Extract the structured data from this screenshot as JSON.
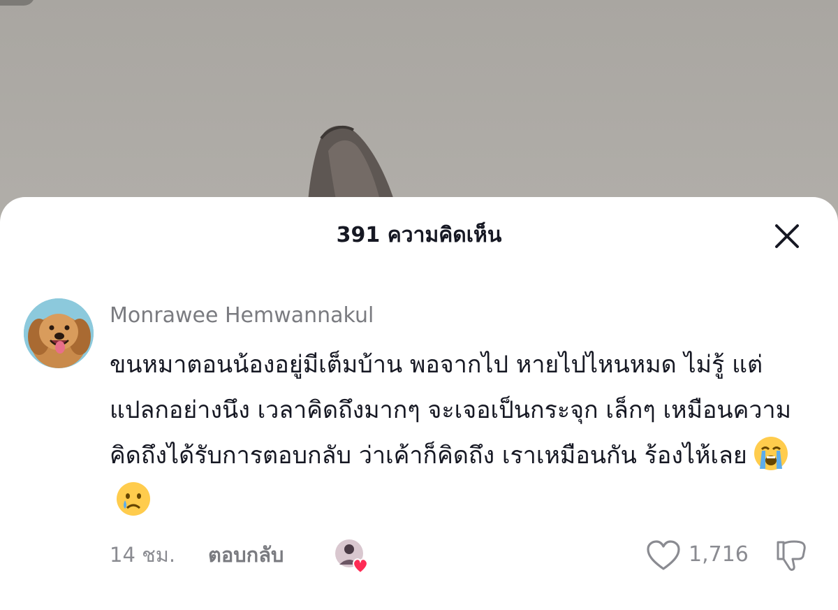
{
  "comments_sheet": {
    "title": "391 ความคิดเห็น"
  },
  "comment": {
    "author": "Monrawee Hemwannakul",
    "text": "ขนหมาตอนน้องอยู่มีเต็มบ้าน พอจากไป หายไปไหนหมด ไม่รู้ แต่แปลกอย่างนึง เวลาคิดถึงมากๆ จะเจอเป็นกระจุก เล็กๆ เหมือนความคิดถึงได้รับการตอบกลับ ว่าเค้าก็คิดถึง เราเหมือนกัน ร้องไห้เลย",
    "emojis": [
      "loudly-crying-face",
      "crying-face"
    ],
    "time": "14 ชม.",
    "reply_label": "ตอบกลับ",
    "like_count": "1,716",
    "liked_by_creator": true
  },
  "colors": {
    "text_primary": "#161823",
    "text_secondary": "#8a8b91",
    "heart_accent": "#fe2c55",
    "sheet_background": "#ffffff"
  }
}
